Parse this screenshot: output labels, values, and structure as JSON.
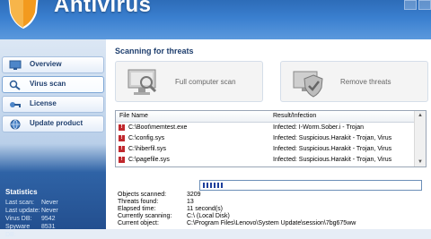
{
  "header": {
    "title": "Antivirus"
  },
  "sidebar": {
    "items": [
      {
        "label": "Overview",
        "icon": "monitor-icon"
      },
      {
        "label": "Virus scan",
        "icon": "magnifier-icon"
      },
      {
        "label": "License",
        "icon": "key-icon"
      },
      {
        "label": "Update product",
        "icon": "globe-icon"
      }
    ],
    "active_index": 1
  },
  "stats": {
    "title": "Statistics",
    "rows": [
      {
        "key": "Last scan:",
        "value": "Never"
      },
      {
        "key": "Last update:",
        "value": "Never"
      },
      {
        "key": "Virus DB:",
        "value": "9542"
      },
      {
        "key": "Spyware DB:",
        "value": "8531"
      }
    ]
  },
  "main": {
    "section_title": "Scanning for threats",
    "full_scan_label": "Full computer scan",
    "remove_label": "Remove threats"
  },
  "table": {
    "headers": [
      "File Name",
      "Result/Infection"
    ],
    "rows": [
      {
        "file": "C:\\Boot\\memtest.exe",
        "result": "Infected: I-Worm.Sober.i - Trojan"
      },
      {
        "file": "C:\\config.sys",
        "result": "Infected: Suspicious.Harakit - Trojan, Virus"
      },
      {
        "file": "C:\\hiberfil.sys",
        "result": "Infected: Suspicious.Harakit - Trojan, Virus"
      },
      {
        "file": "C:\\pagefile.sys",
        "result": "Infected: Suspicious.Harakit - Trojan, Virus"
      }
    ]
  },
  "progress": {
    "segments": 6
  },
  "scan_info": [
    {
      "key": "Objects scanned:",
      "value": "3209"
    },
    {
      "key": "Threats found:",
      "value": "13"
    },
    {
      "key": "Elapsed time:",
      "value": "11 second(s)"
    },
    {
      "key": "Currently scanning:",
      "value": "C:\\ (Local Disk)"
    },
    {
      "key": "Current object:",
      "value": "C:\\Program Files\\Lenovo\\System Update\\session\\7bg675ww"
    }
  ],
  "colors": {
    "accent": "#2d6cb8",
    "threat": "#c0282d",
    "progress": "#1d3f9c"
  }
}
